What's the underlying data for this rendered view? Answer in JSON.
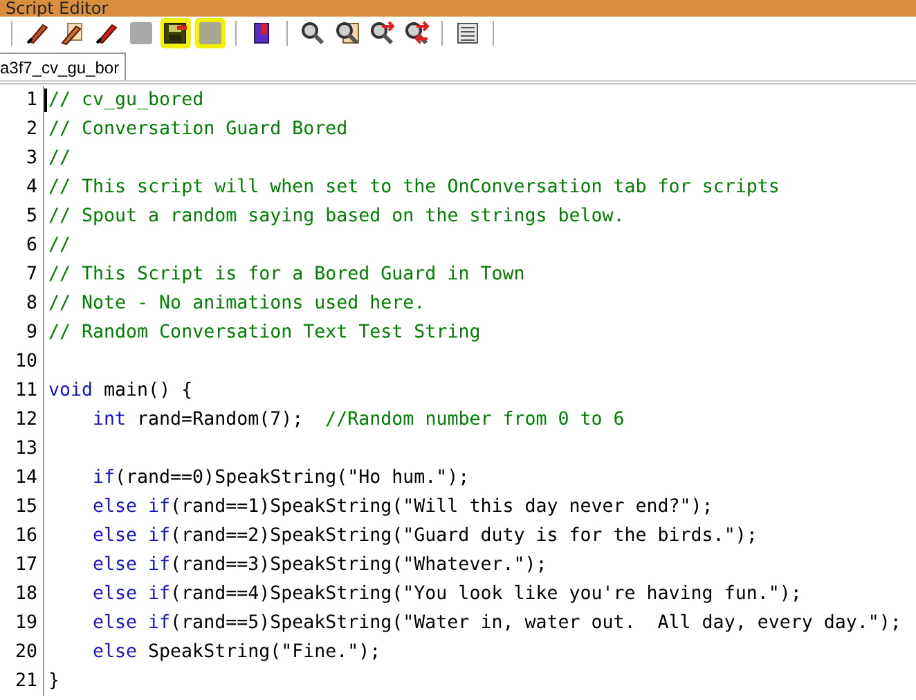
{
  "window": {
    "title": "Script Editor"
  },
  "toolbar": {
    "groups": [
      [
        {
          "kind": "quill",
          "disabled": false,
          "highlighted": false
        },
        {
          "kind": "quill-paper",
          "disabled": false,
          "highlighted": false
        },
        {
          "kind": "quill-red",
          "disabled": false,
          "highlighted": false
        },
        {
          "kind": "blank",
          "disabled": true,
          "highlighted": false
        },
        {
          "kind": "floppy",
          "disabled": false,
          "highlighted": true
        },
        {
          "kind": "blank",
          "disabled": true,
          "highlighted": true
        }
      ],
      [
        {
          "kind": "book",
          "disabled": false,
          "highlighted": false
        }
      ],
      [
        {
          "kind": "magnifier",
          "disabled": false,
          "highlighted": false
        },
        {
          "kind": "magnifier-doc",
          "disabled": false,
          "highlighted": false
        },
        {
          "kind": "magnifier-arrow",
          "disabled": false,
          "highlighted": false
        },
        {
          "kind": "magnifier-arrows",
          "disabled": false,
          "highlighted": false
        }
      ],
      [
        {
          "kind": "list",
          "disabled": false,
          "highlighted": false
        }
      ]
    ]
  },
  "tabs": [
    {
      "label": "a3f7_cv_gu_bor",
      "selected": true
    }
  ],
  "editor": {
    "lines": [
      {
        "number": "1",
        "cursor": true,
        "tokens": [
          {
            "kind": "comment",
            "text": "// cv_gu_bored"
          }
        ]
      },
      {
        "number": "2",
        "tokens": [
          {
            "kind": "comment",
            "text": "// Conversation Guard Bored"
          }
        ]
      },
      {
        "number": "3",
        "tokens": [
          {
            "kind": "comment",
            "text": "//"
          }
        ]
      },
      {
        "number": "4",
        "tokens": [
          {
            "kind": "comment",
            "text": "// This script will when set to the OnConversation tab for scripts"
          }
        ]
      },
      {
        "number": "5",
        "tokens": [
          {
            "kind": "comment",
            "text": "// Spout a random saying based on the strings below."
          }
        ]
      },
      {
        "number": "6",
        "tokens": [
          {
            "kind": "comment",
            "text": "//"
          }
        ]
      },
      {
        "number": "7",
        "tokens": [
          {
            "kind": "comment",
            "text": "// This Script is for a Bored Guard in Town"
          }
        ]
      },
      {
        "number": "8",
        "tokens": [
          {
            "kind": "comment",
            "text": "// Note - No animations used here."
          }
        ]
      },
      {
        "number": "9",
        "tokens": [
          {
            "kind": "comment",
            "text": "// Random Conversation Text Test String"
          }
        ]
      },
      {
        "number": "10"
      },
      {
        "number": "11",
        "tokens": [
          {
            "kind": "keyword",
            "text": "void"
          },
          {
            "kind": "plain",
            "text": " main() {"
          }
        ],
        "children": [
          {
            "number": "12",
            "tokens": [
              {
                "kind": "keyword",
                "text": "int"
              },
              {
                "kind": "plain",
                "text": " rand=Random(7);  "
              },
              {
                "kind": "comment",
                "text": "//Random number from 0 to 6"
              }
            ]
          },
          {
            "number": "13"
          },
          {
            "number": "14",
            "tokens": [
              {
                "kind": "keyword",
                "text": "if"
              },
              {
                "kind": "plain",
                "text": "(rand==0)SpeakString(\"Ho hum.\");"
              }
            ]
          },
          {
            "number": "15",
            "tokens": [
              {
                "kind": "keyword",
                "text": "else if"
              },
              {
                "kind": "plain",
                "text": "(rand==1)SpeakString(\"Will this day never end?\");"
              }
            ]
          },
          {
            "number": "16",
            "tokens": [
              {
                "kind": "keyword",
                "text": "else if"
              },
              {
                "kind": "plain",
                "text": "(rand==2)SpeakString(\"Guard duty is for the birds.\");"
              }
            ]
          },
          {
            "number": "17",
            "tokens": [
              {
                "kind": "keyword",
                "text": "else if"
              },
              {
                "kind": "plain",
                "text": "(rand==3)SpeakString(\"Whatever.\");"
              }
            ]
          },
          {
            "number": "18",
            "tokens": [
              {
                "kind": "keyword",
                "text": "else if"
              },
              {
                "kind": "plain",
                "text": "(rand==4)SpeakString(\"You look like you're having fun.\");"
              }
            ]
          },
          {
            "number": "19",
            "tokens": [
              {
                "kind": "keyword",
                "text": "else if"
              },
              {
                "kind": "plain",
                "text": "(rand==5)SpeakString(\"Water in, water out.  All day, every day.\");"
              }
            ]
          },
          {
            "number": "20",
            "tokens": [
              {
                "kind": "keyword",
                "text": "else"
              },
              {
                "kind": "plain",
                "text": " SpeakString(\"Fine.\");"
              }
            ]
          }
        ]
      },
      {
        "number": "21",
        "tokens": [
          {
            "kind": "plain",
            "text": "}"
          }
        ]
      }
    ]
  }
}
